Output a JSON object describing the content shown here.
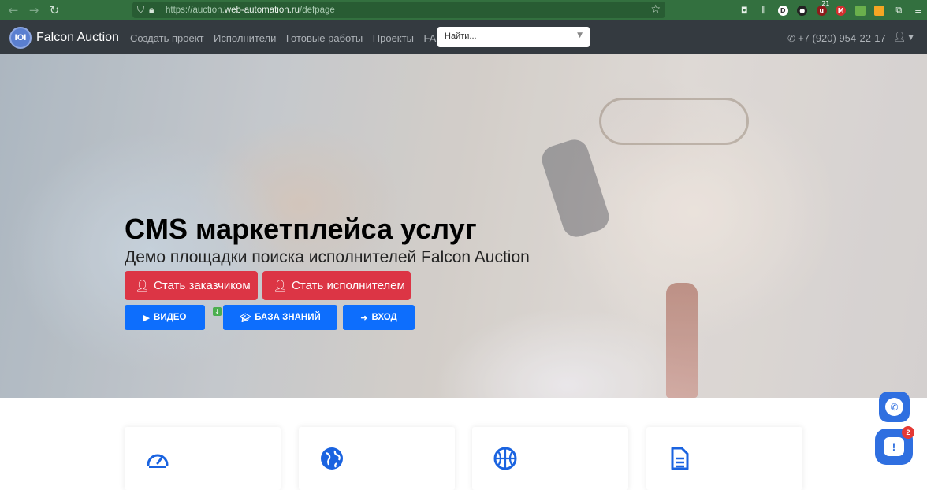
{
  "browser": {
    "url_prefix": "https://auction.",
    "url_host": "web-automation.ru",
    "url_path": "/defpage",
    "ext_badge": "21",
    "icons": [
      "back-arrow-icon",
      "forward-arrow-icon",
      "reload-icon",
      "shield-icon",
      "lock-icon",
      "bookmark-star-icon",
      "pocket-icon",
      "library-icon",
      "extension-icon",
      "menu-icon"
    ]
  },
  "nav": {
    "brand_logo": "IOI",
    "brand": "Falcon Auction",
    "links": [
      "Создать проект",
      "Исполнители",
      "Готовые работы",
      "Проекты",
      "FAQ"
    ],
    "search_placeholder": "Найти...",
    "phone": "+7 (920) 954-22-17"
  },
  "hero": {
    "title": "CMS маркетплейса услуг",
    "subtitle": "Демо площадки поиска исполнителей Falcon Auction",
    "btn_customer": "Стать заказчиком",
    "btn_performer": "Стать исполнителем",
    "btn_video": "ВИДЕО",
    "btn_kb": "БАЗА ЗНАНИЙ",
    "btn_login": "ВХОД"
  },
  "cards": {
    "icons": [
      "speedometer-icon",
      "globe-icon",
      "basketball-icon",
      "document-icon"
    ]
  },
  "widgets": {
    "chat_badge": "2",
    "chat_glyph": "!"
  },
  "colors": {
    "browser_chrome": "#33703f",
    "navbar": "#343a40",
    "red_button": "#dc3545",
    "blue_button": "#0d6efd",
    "icon_blue": "#1a63e0"
  }
}
